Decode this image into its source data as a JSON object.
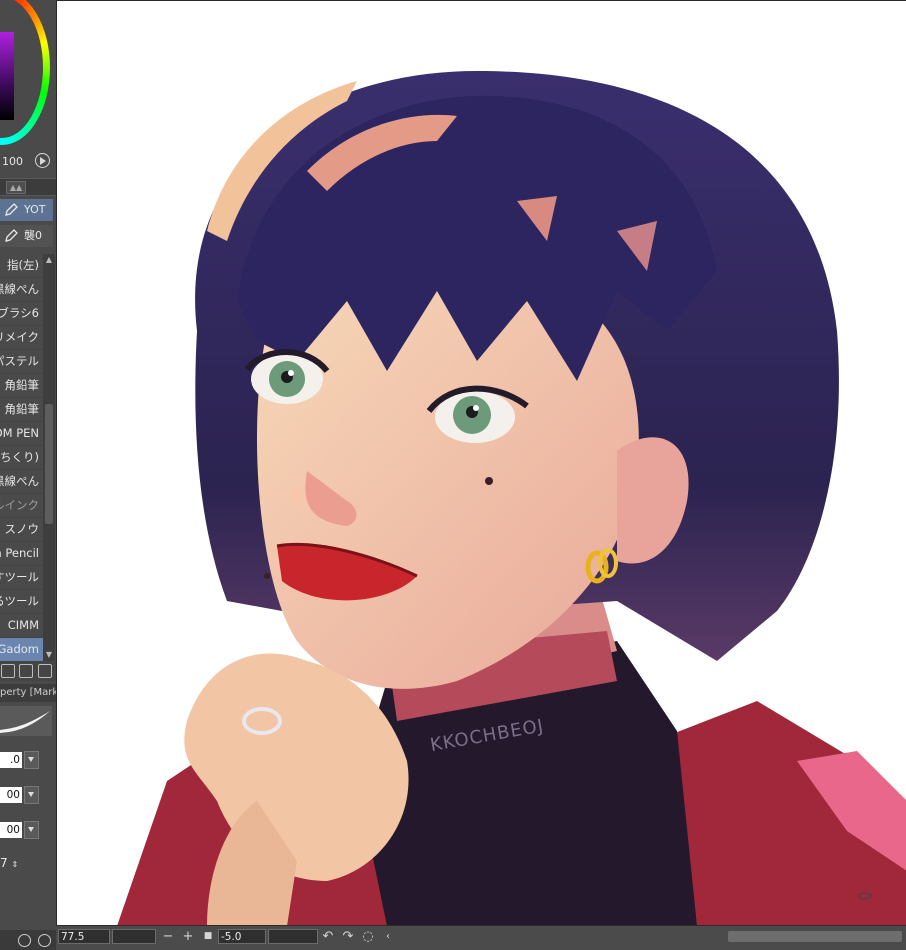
{
  "color_panel": {
    "opacity_value": "100",
    "color_square_color": "#7a1fb0"
  },
  "subtool_groups": [
    {
      "label": "YOT",
      "selected": true
    },
    {
      "label": "襲0",
      "selected": false
    }
  ],
  "brush_list": [
    "指(左)",
    "黒線ぺん",
    "ブラシ6",
    "リメイク",
    "パステル",
    "角鉛筆",
    "角鉛筆",
    "OM PEN",
    "ん(ちくり)",
    "黒線ぺん",
    "ザルインク",
    "フ スノウ",
    "m Pencil",
    "すツール",
    "るツール",
    "CIMM",
    "r Gadom"
  ],
  "brush_selected_index": 16,
  "tool_property": {
    "header": "perty [Mark",
    "rows": [
      ".0",
      "00",
      "00"
    ],
    "last_value": "7"
  },
  "artwork": {
    "signature_text": "KKOCHBEOJ"
  },
  "navigator": {
    "zoom": "77.5",
    "rotation": "-5.0"
  }
}
